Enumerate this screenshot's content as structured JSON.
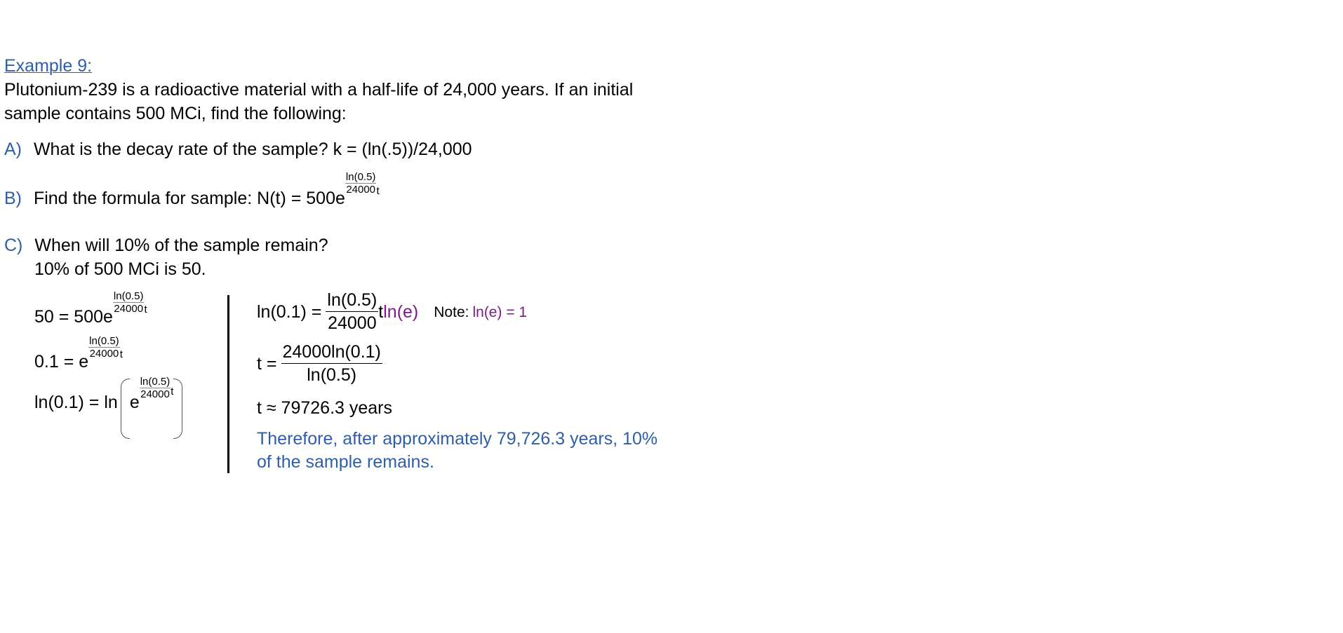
{
  "heading": "Example 9:",
  "problem": {
    "line1": "Plutonium-239 is a radioactive material with a half-life of 24,000 years.  If an initial",
    "line2": "sample contains 500 MCi, find the following:"
  },
  "parts": {
    "a": {
      "label": "A)",
      "text": "What is the decay rate of the sample?  k = (ln(.5))/24,000"
    },
    "b": {
      "label": "B)",
      "text": "Find the formula for sample:  N(t) = 500e",
      "exp_num": "ln(0.5)",
      "exp_den": "24000",
      "exp_t": "t"
    },
    "c": {
      "label": "C)",
      "text": "When will 10% of the sample remain?",
      "sub": "10% of 500 MCi is 50."
    }
  },
  "left_steps": {
    "s1": {
      "lhs": "50 = 500e"
    },
    "s2": {
      "lhs": "0.1 = e"
    },
    "s3": {
      "lhs": "ln(0.1) = ln",
      "e": "e"
    },
    "exp_num": "ln(0.5)",
    "exp_den": "24000",
    "exp_t": "t"
  },
  "right_steps": {
    "r1": {
      "lhs": "ln(0.1) =",
      "num": "ln(0.5)",
      "den": "24000",
      "t": "t",
      "lne": "ln(e)",
      "note_label": "Note:",
      "note_value": "ln(e) = 1"
    },
    "r2": {
      "lhs": "t =",
      "num": "24000ln(0.1)",
      "den": "ln(0.5)"
    },
    "r3": "t ≈ 79726.3 years",
    "conclusion1": "Therefore, after approximately 79,726.3 years, 10%",
    "conclusion2": "of the sample remains."
  }
}
